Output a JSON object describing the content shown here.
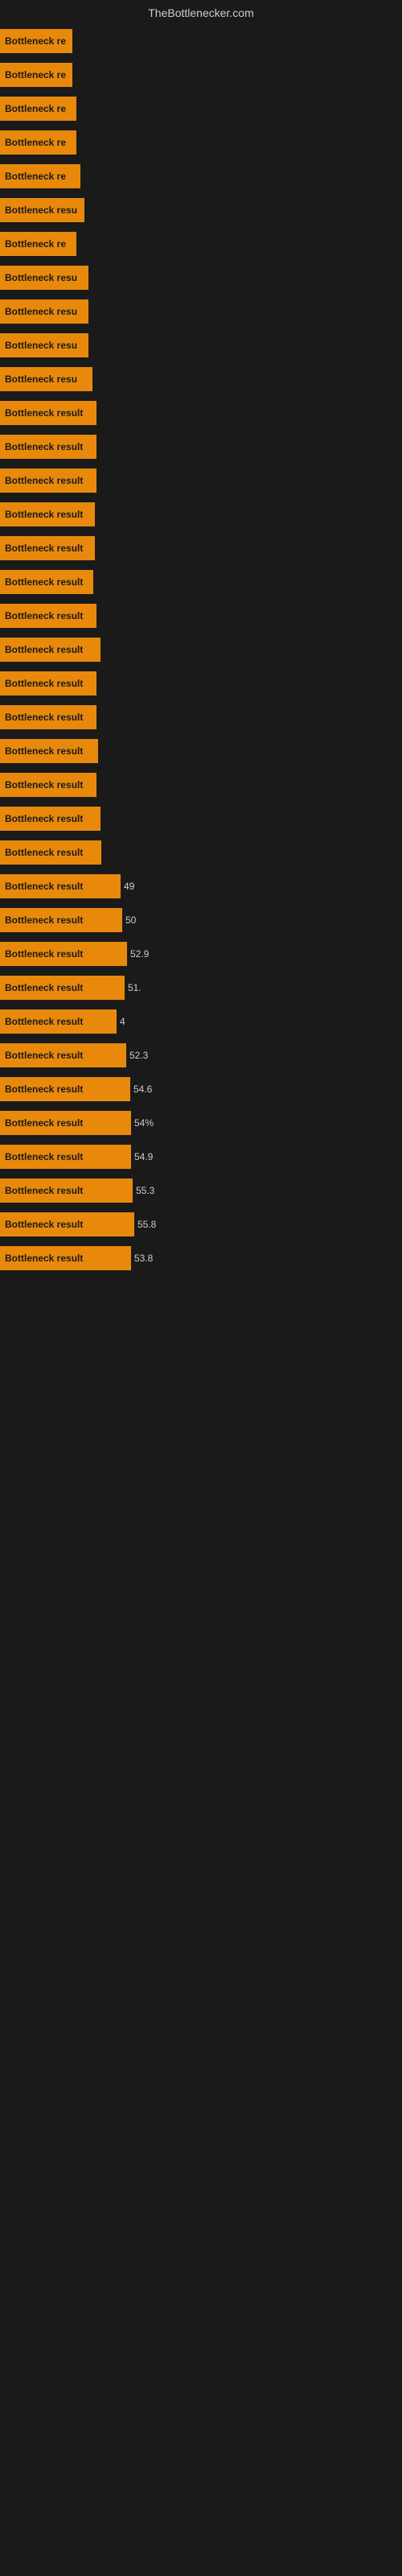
{
  "header": {
    "title": "TheBottlenecker.com"
  },
  "rows": [
    {
      "label": "Bottleneck re",
      "width": 90,
      "value": ""
    },
    {
      "label": "Bottleneck re",
      "width": 90,
      "value": ""
    },
    {
      "label": "Bottleneck re",
      "width": 95,
      "value": ""
    },
    {
      "label": "Bottleneck re",
      "width": 95,
      "value": ""
    },
    {
      "label": "Bottleneck re",
      "width": 100,
      "value": ""
    },
    {
      "label": "Bottleneck resu",
      "width": 105,
      "value": ""
    },
    {
      "label": "Bottleneck re",
      "width": 95,
      "value": ""
    },
    {
      "label": "Bottleneck resu",
      "width": 110,
      "value": ""
    },
    {
      "label": "Bottleneck resu",
      "width": 110,
      "value": ""
    },
    {
      "label": "Bottleneck resu",
      "width": 110,
      "value": ""
    },
    {
      "label": "Bottleneck resu",
      "width": 115,
      "value": ""
    },
    {
      "label": "Bottleneck result",
      "width": 120,
      "value": ""
    },
    {
      "label": "Bottleneck result",
      "width": 120,
      "value": ""
    },
    {
      "label": "Bottleneck result",
      "width": 120,
      "value": ""
    },
    {
      "label": "Bottleneck result",
      "width": 118,
      "value": ""
    },
    {
      "label": "Bottleneck result",
      "width": 118,
      "value": ""
    },
    {
      "label": "Bottleneck result",
      "width": 116,
      "value": ""
    },
    {
      "label": "Bottleneck result",
      "width": 120,
      "value": ""
    },
    {
      "label": "Bottleneck result",
      "width": 125,
      "value": ""
    },
    {
      "label": "Bottleneck result",
      "width": 120,
      "value": ""
    },
    {
      "label": "Bottleneck result",
      "width": 120,
      "value": ""
    },
    {
      "label": "Bottleneck result",
      "width": 122,
      "value": ""
    },
    {
      "label": "Bottleneck result",
      "width": 120,
      "value": ""
    },
    {
      "label": "Bottleneck result",
      "width": 125,
      "value": ""
    },
    {
      "label": "Bottleneck result",
      "width": 126,
      "value": ""
    },
    {
      "label": "Bottleneck result",
      "width": 150,
      "value": "49"
    },
    {
      "label": "Bottleneck result",
      "width": 152,
      "value": "50"
    },
    {
      "label": "Bottleneck result",
      "width": 158,
      "value": "52.9"
    },
    {
      "label": "Bottleneck result",
      "width": 155,
      "value": "51."
    },
    {
      "label": "Bottleneck result",
      "width": 145,
      "value": "4"
    },
    {
      "label": "Bottleneck result",
      "width": 157,
      "value": "52.3"
    },
    {
      "label": "Bottleneck result",
      "width": 162,
      "value": "54.6"
    },
    {
      "label": "Bottleneck result",
      "width": 163,
      "value": "54%"
    },
    {
      "label": "Bottleneck result",
      "width": 163,
      "value": "54.9"
    },
    {
      "label": "Bottleneck result",
      "width": 165,
      "value": "55.3"
    },
    {
      "label": "Bottleneck result",
      "width": 167,
      "value": "55.8"
    },
    {
      "label": "Bottleneck result",
      "width": 163,
      "value": "53.8"
    }
  ]
}
